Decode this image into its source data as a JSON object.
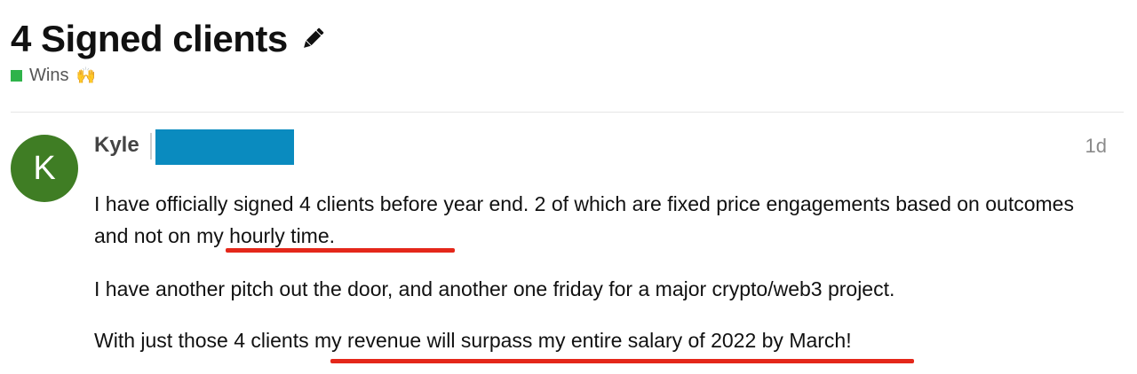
{
  "topic": {
    "title": "4 Signed clients",
    "category": {
      "label": "Wins",
      "emoji": "🙌",
      "color": "#2fb34a"
    }
  },
  "post": {
    "avatar_letter": "K",
    "avatar_color": "#3f7d24",
    "author": "Kyle",
    "redaction_color": "#0a8bbf",
    "date": "1d",
    "paragraphs": [
      "I have officially signed 4 clients before year end. 2 of which are fixed price engagements based on outcomes and not on my hourly time.",
      "I have another pitch out the door, and another one friday for a major crypto/web3 project.",
      "With just those 4 clients my revenue will surpass my entire salary of 2022 by March!"
    ],
    "highlight_color": "#e4271a"
  },
  "icons": {
    "edit": "pencil-icon"
  }
}
